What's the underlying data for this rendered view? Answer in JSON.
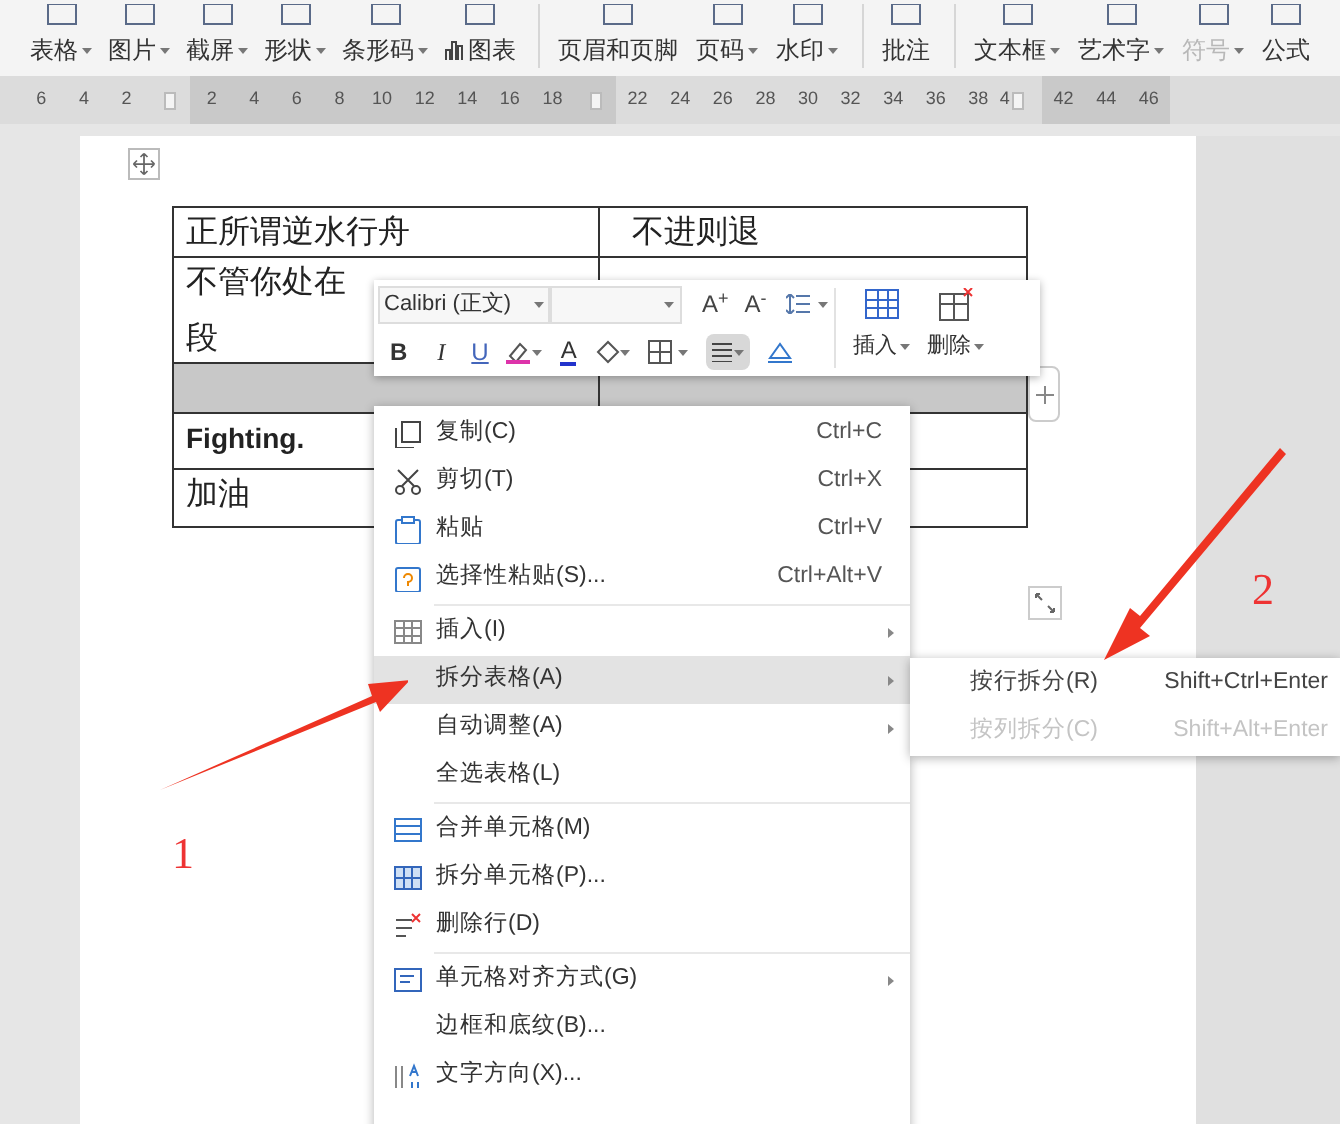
{
  "toolbar": {
    "groups": [
      [
        {
          "label": "表格",
          "dropdown": true,
          "disabled": false
        },
        {
          "label": "图片",
          "dropdown": true,
          "disabled": false
        },
        {
          "label": "截屏",
          "dropdown": true,
          "disabled": false
        },
        {
          "label": "形状",
          "dropdown": true,
          "disabled": false
        },
        {
          "label": "条形码",
          "dropdown": true,
          "disabled": false
        },
        {
          "label": "图表",
          "dropdown": false,
          "disabled": false
        }
      ],
      [
        {
          "label": "页眉和页脚",
          "dropdown": false,
          "disabled": false
        },
        {
          "label": "页码",
          "dropdown": true,
          "disabled": false
        },
        {
          "label": "水印",
          "dropdown": true,
          "disabled": false
        }
      ],
      [
        {
          "label": "批注",
          "dropdown": false,
          "disabled": false
        }
      ],
      [
        {
          "label": "文本框",
          "dropdown": true,
          "disabled": false
        },
        {
          "label": "艺术字",
          "dropdown": true,
          "disabled": false
        },
        {
          "label": "符号",
          "dropdown": true,
          "disabled": true
        },
        {
          "label": "公式",
          "dropdown": false,
          "disabled": false
        }
      ]
    ]
  },
  "ruler": [
    {
      "kind": "num",
      "label": "6"
    },
    {
      "kind": "num",
      "label": "4"
    },
    {
      "kind": "num",
      "label": "2"
    },
    {
      "kind": "marker"
    },
    {
      "kind": "num",
      "label": "2"
    },
    {
      "kind": "num",
      "label": "4"
    },
    {
      "kind": "num",
      "label": "6"
    },
    {
      "kind": "num",
      "label": "8"
    },
    {
      "kind": "num",
      "label": "10"
    },
    {
      "kind": "num",
      "label": "12"
    },
    {
      "kind": "num",
      "label": "14"
    },
    {
      "kind": "num",
      "label": "16"
    },
    {
      "kind": "num",
      "label": "18"
    },
    {
      "kind": "marker"
    },
    {
      "kind": "num",
      "label": "22"
    },
    {
      "kind": "num",
      "label": "24"
    },
    {
      "kind": "num",
      "label": "26"
    },
    {
      "kind": "num",
      "label": "28"
    },
    {
      "kind": "num",
      "label": "30"
    },
    {
      "kind": "num",
      "label": "32"
    },
    {
      "kind": "num",
      "label": "34"
    },
    {
      "kind": "num",
      "label": "36"
    },
    {
      "kind": "num",
      "label": "38"
    },
    {
      "kind": "num_marker",
      "label": "4"
    },
    {
      "kind": "num",
      "label": "42"
    },
    {
      "kind": "num",
      "label": "44"
    },
    {
      "kind": "num",
      "label": "46"
    }
  ],
  "table": {
    "rows": [
      {
        "selected": false,
        "cells": [
          [
            "正所谓逆水行舟"
          ],
          [
            "不进则退"
          ]
        ]
      },
      {
        "selected": false,
        "cells": [
          [
            "不管你处在",
            "段"
          ],
          []
        ]
      },
      {
        "selected": true,
        "cells": [
          [],
          []
        ]
      },
      {
        "selected": false,
        "cells": [
          [
            "Fighting."
          ],
          []
        ]
      },
      {
        "selected": false,
        "cells": [
          [
            "加油"
          ],
          []
        ]
      }
    ]
  },
  "mini_toolbar": {
    "font": "Calibri (正文)",
    "grow": "A$^{+}$",
    "shrink": "A$^{-}$",
    "bold": "B",
    "italic": "I",
    "underline": "U",
    "font_color": "A",
    "align_selected": true,
    "insert": "插入",
    "delete": "删除"
  },
  "context_menu": {
    "groups": [
      [
        {
          "label": "复制(C)",
          "shortcut": "Ctrl+C",
          "submenu": false,
          "selected": false
        },
        {
          "label": "剪切(T)",
          "shortcut": "Ctrl+X",
          "submenu": false,
          "selected": false
        },
        {
          "label": "粘贴",
          "shortcut": "Ctrl+V",
          "submenu": false,
          "selected": false
        },
        {
          "label": "选择性粘贴(S)...",
          "shortcut": "Ctrl+Alt+V",
          "submenu": false,
          "selected": false
        }
      ],
      [
        {
          "label": "插入(I)",
          "submenu": true,
          "selected": false
        },
        {
          "label": "拆分表格(A)",
          "submenu": true,
          "selected": true
        },
        {
          "label": "自动调整(A)",
          "submenu": true,
          "selected": false
        },
        {
          "label": "全选表格(L)",
          "submenu": false,
          "selected": false
        }
      ],
      [
        {
          "label": "合并单元格(M)",
          "submenu": false,
          "selected": false
        },
        {
          "label": "拆分单元格(P)...",
          "submenu": false,
          "selected": false
        },
        {
          "label": "删除行(D)",
          "submenu": false,
          "selected": false
        }
      ],
      [
        {
          "label": "单元格对齐方式(G)",
          "submenu": true,
          "selected": false
        },
        {
          "label": "边框和底纹(B)...",
          "submenu": false,
          "selected": false
        },
        {
          "label": "文字方向(X)...",
          "submenu": false,
          "selected": false
        }
      ]
    ]
  },
  "submenu": {
    "items": [
      {
        "label": "按行拆分(R)",
        "shortcut": "Shift+Ctrl+Enter",
        "disabled": false
      },
      {
        "label": "按列拆分(C)",
        "shortcut": "Shift+Alt+Enter",
        "disabled": true
      }
    ]
  },
  "callouts": [
    {
      "label": "1"
    },
    {
      "label": "2"
    }
  ]
}
